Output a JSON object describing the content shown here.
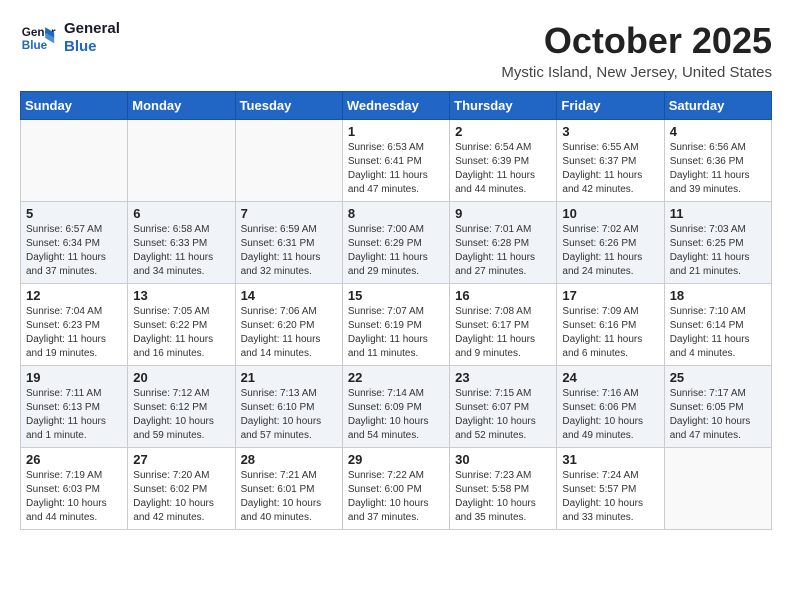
{
  "header": {
    "logo_line1": "General",
    "logo_line2": "Blue",
    "title": "October 2025",
    "subtitle": "Mystic Island, New Jersey, United States"
  },
  "weekdays": [
    "Sunday",
    "Monday",
    "Tuesday",
    "Wednesday",
    "Thursday",
    "Friday",
    "Saturday"
  ],
  "weeks": [
    [
      {
        "day": "",
        "info": ""
      },
      {
        "day": "",
        "info": ""
      },
      {
        "day": "",
        "info": ""
      },
      {
        "day": "1",
        "info": "Sunrise: 6:53 AM\nSunset: 6:41 PM\nDaylight: 11 hours\nand 47 minutes."
      },
      {
        "day": "2",
        "info": "Sunrise: 6:54 AM\nSunset: 6:39 PM\nDaylight: 11 hours\nand 44 minutes."
      },
      {
        "day": "3",
        "info": "Sunrise: 6:55 AM\nSunset: 6:37 PM\nDaylight: 11 hours\nand 42 minutes."
      },
      {
        "day": "4",
        "info": "Sunrise: 6:56 AM\nSunset: 6:36 PM\nDaylight: 11 hours\nand 39 minutes."
      }
    ],
    [
      {
        "day": "5",
        "info": "Sunrise: 6:57 AM\nSunset: 6:34 PM\nDaylight: 11 hours\nand 37 minutes."
      },
      {
        "day": "6",
        "info": "Sunrise: 6:58 AM\nSunset: 6:33 PM\nDaylight: 11 hours\nand 34 minutes."
      },
      {
        "day": "7",
        "info": "Sunrise: 6:59 AM\nSunset: 6:31 PM\nDaylight: 11 hours\nand 32 minutes."
      },
      {
        "day": "8",
        "info": "Sunrise: 7:00 AM\nSunset: 6:29 PM\nDaylight: 11 hours\nand 29 minutes."
      },
      {
        "day": "9",
        "info": "Sunrise: 7:01 AM\nSunset: 6:28 PM\nDaylight: 11 hours\nand 27 minutes."
      },
      {
        "day": "10",
        "info": "Sunrise: 7:02 AM\nSunset: 6:26 PM\nDaylight: 11 hours\nand 24 minutes."
      },
      {
        "day": "11",
        "info": "Sunrise: 7:03 AM\nSunset: 6:25 PM\nDaylight: 11 hours\nand 21 minutes."
      }
    ],
    [
      {
        "day": "12",
        "info": "Sunrise: 7:04 AM\nSunset: 6:23 PM\nDaylight: 11 hours\nand 19 minutes."
      },
      {
        "day": "13",
        "info": "Sunrise: 7:05 AM\nSunset: 6:22 PM\nDaylight: 11 hours\nand 16 minutes."
      },
      {
        "day": "14",
        "info": "Sunrise: 7:06 AM\nSunset: 6:20 PM\nDaylight: 11 hours\nand 14 minutes."
      },
      {
        "day": "15",
        "info": "Sunrise: 7:07 AM\nSunset: 6:19 PM\nDaylight: 11 hours\nand 11 minutes."
      },
      {
        "day": "16",
        "info": "Sunrise: 7:08 AM\nSunset: 6:17 PM\nDaylight: 11 hours\nand 9 minutes."
      },
      {
        "day": "17",
        "info": "Sunrise: 7:09 AM\nSunset: 6:16 PM\nDaylight: 11 hours\nand 6 minutes."
      },
      {
        "day": "18",
        "info": "Sunrise: 7:10 AM\nSunset: 6:14 PM\nDaylight: 11 hours\nand 4 minutes."
      }
    ],
    [
      {
        "day": "19",
        "info": "Sunrise: 7:11 AM\nSunset: 6:13 PM\nDaylight: 11 hours\nand 1 minute."
      },
      {
        "day": "20",
        "info": "Sunrise: 7:12 AM\nSunset: 6:12 PM\nDaylight: 10 hours\nand 59 minutes."
      },
      {
        "day": "21",
        "info": "Sunrise: 7:13 AM\nSunset: 6:10 PM\nDaylight: 10 hours\nand 57 minutes."
      },
      {
        "day": "22",
        "info": "Sunrise: 7:14 AM\nSunset: 6:09 PM\nDaylight: 10 hours\nand 54 minutes."
      },
      {
        "day": "23",
        "info": "Sunrise: 7:15 AM\nSunset: 6:07 PM\nDaylight: 10 hours\nand 52 minutes."
      },
      {
        "day": "24",
        "info": "Sunrise: 7:16 AM\nSunset: 6:06 PM\nDaylight: 10 hours\nand 49 minutes."
      },
      {
        "day": "25",
        "info": "Sunrise: 7:17 AM\nSunset: 6:05 PM\nDaylight: 10 hours\nand 47 minutes."
      }
    ],
    [
      {
        "day": "26",
        "info": "Sunrise: 7:19 AM\nSunset: 6:03 PM\nDaylight: 10 hours\nand 44 minutes."
      },
      {
        "day": "27",
        "info": "Sunrise: 7:20 AM\nSunset: 6:02 PM\nDaylight: 10 hours\nand 42 minutes."
      },
      {
        "day": "28",
        "info": "Sunrise: 7:21 AM\nSunset: 6:01 PM\nDaylight: 10 hours\nand 40 minutes."
      },
      {
        "day": "29",
        "info": "Sunrise: 7:22 AM\nSunset: 6:00 PM\nDaylight: 10 hours\nand 37 minutes."
      },
      {
        "day": "30",
        "info": "Sunrise: 7:23 AM\nSunset: 5:58 PM\nDaylight: 10 hours\nand 35 minutes."
      },
      {
        "day": "31",
        "info": "Sunrise: 7:24 AM\nSunset: 5:57 PM\nDaylight: 10 hours\nand 33 minutes."
      },
      {
        "day": "",
        "info": ""
      }
    ]
  ]
}
